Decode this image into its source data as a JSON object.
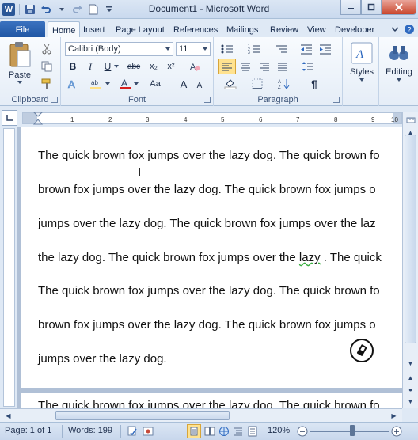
{
  "app": {
    "title": "Document1  -  Microsoft Word",
    "logo_letter": "W"
  },
  "qat": {
    "icons": [
      "save-icon",
      "undo-icon",
      "redo-icon",
      "new-doc-icon",
      "customize-icon"
    ]
  },
  "tabs": {
    "file": "File",
    "items": [
      "Home",
      "Insert",
      "Page Layout",
      "References",
      "Mailings",
      "Review",
      "View",
      "Developer"
    ],
    "active": "Home"
  },
  "ribbon": {
    "clipboard": {
      "label": "Clipboard",
      "paste": "Paste"
    },
    "font": {
      "label": "Font",
      "font_name": "Calibri (Body)",
      "font_size": "11",
      "bold": "B",
      "italic": "I",
      "underline": "U",
      "strike": "abc",
      "subscript": "x₂",
      "superscript": "x²",
      "case": "Aa",
      "grow": "A",
      "shrink": "A"
    },
    "paragraph": {
      "label": "Paragraph",
      "pilcrow": "¶"
    },
    "styles": {
      "label": "Styles"
    },
    "editing": {
      "label": "Editing"
    }
  },
  "ruler": {
    "numbers": [
      "1",
      "2",
      "3",
      "4",
      "5",
      "6",
      "7",
      "8",
      "9",
      "10"
    ]
  },
  "document": {
    "lines": [
      "The quick brown fox jumps over the lazy dog. The quick brown fo",
      "brown fox jumps over the lazy dog. The quick brown fox jumps o",
      "jumps over the lazy dog. The quick brown fox jumps over the laz",
      "the lazy dog. The quick brown fox jumps over the ",
      "The quick brown fox jumps over the lazy dog. The quick brown fo",
      "brown fox jumps over the lazy dog. The quick brown fox jumps o",
      "jumps over the lazy dog."
    ],
    "line4_spell": "lazy",
    "line4_tail": " . The quick",
    "page2_line": "The quick brown fox jumps over the lazy dog. The quick brown fo"
  },
  "status": {
    "page": "Page: 1 of 1",
    "words": "Words: 199",
    "zoom": "120%",
    "zoom_percent": 120
  },
  "colors": {
    "accent": "#2b5797",
    "ribbon_bg": "#e5edf7",
    "highlight": "#ffe186"
  }
}
